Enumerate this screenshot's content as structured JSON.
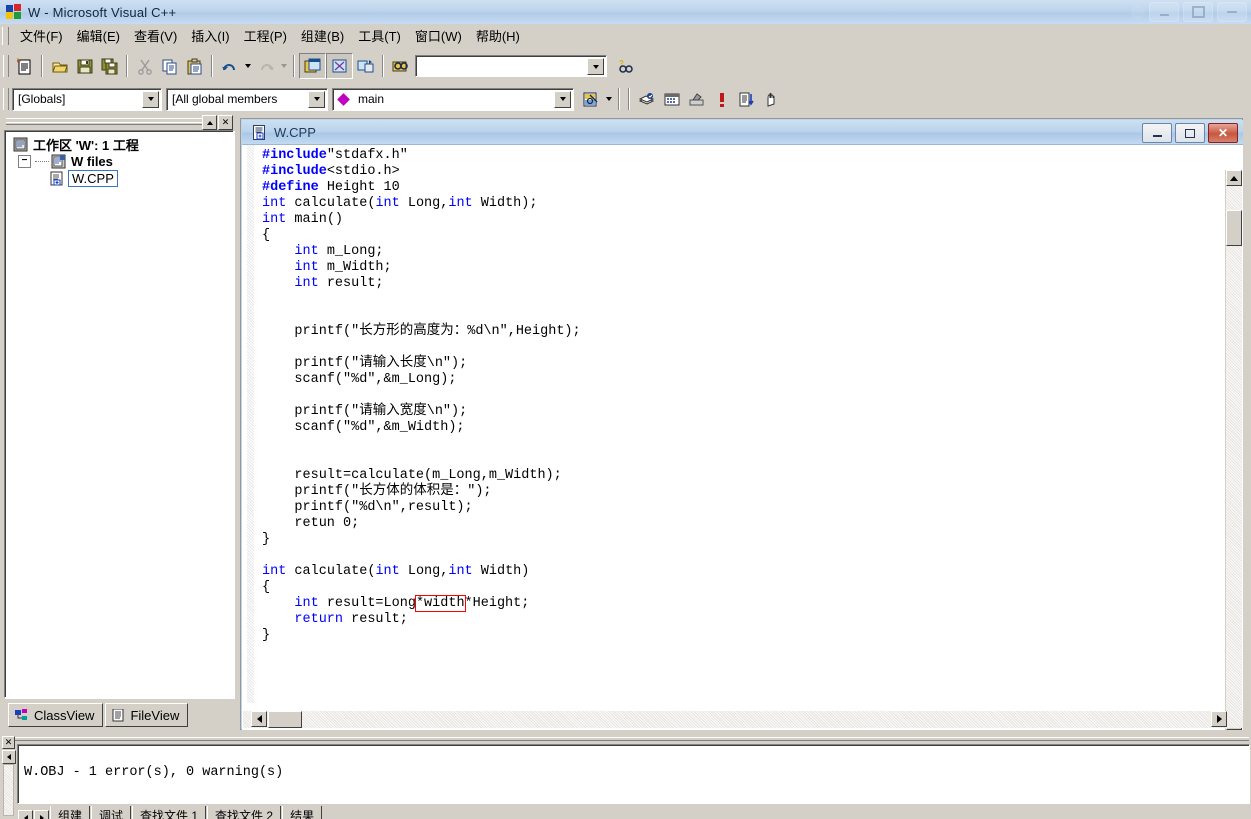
{
  "window": {
    "title": "W - Microsoft Visual C++",
    "icon": "vcpp-logo-icon",
    "buttons": {
      "minimize": "minimize-button",
      "maximize": "maximize-button",
      "close": "close-button"
    }
  },
  "menubar": {
    "items": [
      {
        "label": "文件(F)"
      },
      {
        "label": "编辑(E)"
      },
      {
        "label": "查看(V)"
      },
      {
        "label": "插入(I)"
      },
      {
        "label": "工程(P)"
      },
      {
        "label": "组建(B)"
      },
      {
        "label": "工具(T)"
      },
      {
        "label": "窗口(W)"
      },
      {
        "label": "帮助(H)"
      }
    ]
  },
  "toolbar_standard": {
    "buttons": [
      {
        "name": "new-text-file-icon",
        "tip": "New Text File"
      },
      {
        "name": "open-folder-icon",
        "tip": "Open"
      },
      {
        "name": "save-icon",
        "tip": "Save"
      },
      {
        "name": "save-all-icon",
        "tip": "Save All"
      },
      {
        "name": "cut-scissors-icon",
        "tip": "Cut"
      },
      {
        "name": "copy-icon",
        "tip": "Copy"
      },
      {
        "name": "paste-clipboard-icon",
        "tip": "Paste"
      },
      {
        "name": "undo-icon",
        "tip": "Undo"
      },
      {
        "name": "redo-icon",
        "tip": "Redo"
      },
      {
        "name": "workspace-window-icon",
        "tip": "Workspace"
      },
      {
        "name": "output-window-icon",
        "tip": "Output"
      },
      {
        "name": "window-list-icon",
        "tip": "Windows"
      },
      {
        "name": "find-in-files-icon",
        "tip": "Find in Files"
      },
      {
        "name": "help-find-icon",
        "tip": "Search"
      }
    ],
    "find_combo": {
      "value": "",
      "placeholder": ""
    }
  },
  "toolbar_wizardbar": {
    "scope_combo": {
      "value": "[Globals]"
    },
    "members_combo": {
      "value": "[All global members"
    },
    "function_combo": {
      "value": "main",
      "icon": "member-diamond-icon"
    },
    "buttons": [
      {
        "name": "wizard-action-icon"
      },
      {
        "name": "compile-icon"
      },
      {
        "name": "build-icon"
      },
      {
        "name": "stop-build-icon"
      },
      {
        "name": "execute-program-icon"
      },
      {
        "name": "go-debug-icon"
      },
      {
        "name": "insert-breakpoint-icon"
      }
    ]
  },
  "workspace": {
    "caption_buttons": {
      "roll_up": "roll-up-button",
      "close": "close-button"
    },
    "tree": {
      "root": {
        "label": "工作区 'W': 1 工程",
        "icon": "workspace-icon"
      },
      "project": {
        "label": "W files",
        "icon": "project-folder-icon",
        "expander": "-"
      },
      "file": {
        "label": "W.CPP",
        "icon": "cpp-file-icon",
        "selected": true
      }
    },
    "tabs": [
      {
        "label": "ClassView",
        "icon": "classview-icon",
        "active": false
      },
      {
        "label": "FileView",
        "icon": "fileview-icon",
        "active": true
      }
    ]
  },
  "editor": {
    "title": "W.CPP",
    "title_icon": "source-file-icon",
    "buttons": {
      "minimize": "minimize-button",
      "restore": "restore-button",
      "close": "close-button"
    },
    "code_lines": [
      {
        "segments": [
          {
            "t": "#include",
            "c": "pp"
          },
          {
            "t": "\"stdafx.h\"",
            "c": ""
          }
        ]
      },
      {
        "segments": [
          {
            "t": "#include",
            "c": "pp"
          },
          {
            "t": "<stdio.h>",
            "c": ""
          }
        ]
      },
      {
        "segments": [
          {
            "t": "#define",
            "c": "pp"
          },
          {
            "t": " Height 10",
            "c": ""
          }
        ]
      },
      {
        "segments": [
          {
            "t": "int",
            "c": "kw"
          },
          {
            "t": " calculate(",
            "c": ""
          },
          {
            "t": "int",
            "c": "kw"
          },
          {
            "t": " Long,",
            "c": ""
          },
          {
            "t": "int",
            "c": "kw"
          },
          {
            "t": " Width);",
            "c": ""
          }
        ]
      },
      {
        "segments": [
          {
            "t": "int",
            "c": "kw"
          },
          {
            "t": " main()",
            "c": ""
          }
        ]
      },
      {
        "segments": [
          {
            "t": "{",
            "c": ""
          }
        ]
      },
      {
        "segments": [
          {
            "t": "    ",
            "c": ""
          },
          {
            "t": "int",
            "c": "kw"
          },
          {
            "t": " m_Long;",
            "c": ""
          }
        ]
      },
      {
        "segments": [
          {
            "t": "    ",
            "c": ""
          },
          {
            "t": "int",
            "c": "kw"
          },
          {
            "t": " m_Width;",
            "c": ""
          }
        ]
      },
      {
        "segments": [
          {
            "t": "    ",
            "c": ""
          },
          {
            "t": "int",
            "c": "kw"
          },
          {
            "t": " result;",
            "c": ""
          }
        ]
      },
      {
        "segments": [
          {
            "t": "",
            "c": ""
          }
        ]
      },
      {
        "segments": [
          {
            "t": "",
            "c": ""
          }
        ]
      },
      {
        "segments": [
          {
            "t": "    printf(\"长方形的高度为：%d\\n\",Height);",
            "c": ""
          }
        ]
      },
      {
        "segments": [
          {
            "t": "",
            "c": ""
          }
        ]
      },
      {
        "segments": [
          {
            "t": "    printf(\"请输入长度\\n\");",
            "c": ""
          }
        ]
      },
      {
        "segments": [
          {
            "t": "    scanf(\"%d\",&m_Long);",
            "c": ""
          }
        ]
      },
      {
        "segments": [
          {
            "t": "",
            "c": ""
          }
        ]
      },
      {
        "segments": [
          {
            "t": "    printf(\"请输入宽度\\n\");",
            "c": ""
          }
        ]
      },
      {
        "segments": [
          {
            "t": "    scanf(\"%d\",&m_Width);",
            "c": ""
          }
        ]
      },
      {
        "segments": [
          {
            "t": "",
            "c": ""
          }
        ]
      },
      {
        "segments": [
          {
            "t": "",
            "c": ""
          }
        ]
      },
      {
        "segments": [
          {
            "t": "    result=calculate(m_Long,m_Width);",
            "c": ""
          }
        ]
      },
      {
        "segments": [
          {
            "t": "    printf(\"长方体的体积是：\");",
            "c": ""
          }
        ]
      },
      {
        "segments": [
          {
            "t": "    printf(\"%d\\n\",result);",
            "c": ""
          }
        ]
      },
      {
        "segments": [
          {
            "t": "    retun 0;",
            "c": ""
          }
        ]
      },
      {
        "segments": [
          {
            "t": "}",
            "c": ""
          }
        ]
      },
      {
        "segments": [
          {
            "t": "",
            "c": ""
          }
        ]
      },
      {
        "segments": [
          {
            "t": "int",
            "c": "kw"
          },
          {
            "t": " calculate(",
            "c": ""
          },
          {
            "t": "int",
            "c": "kw"
          },
          {
            "t": " Long,",
            "c": ""
          },
          {
            "t": "int",
            "c": "kw"
          },
          {
            "t": " Width)",
            "c": ""
          }
        ]
      },
      {
        "segments": [
          {
            "t": "{",
            "c": ""
          }
        ]
      },
      {
        "segments": [
          {
            "t": "    ",
            "c": ""
          },
          {
            "t": "int",
            "c": "kw"
          },
          {
            "t": " result=Long",
            "c": ""
          },
          {
            "t": "*width",
            "c": "box"
          },
          {
            "t": "*Height;",
            "c": ""
          }
        ]
      },
      {
        "segments": [
          {
            "t": "    ",
            "c": ""
          },
          {
            "t": "return",
            "c": "kw"
          },
          {
            "t": " result;",
            "c": ""
          }
        ]
      },
      {
        "segments": [
          {
            "t": "}",
            "c": ""
          }
        ]
      }
    ],
    "annotation": {
      "type": "red-rectangle-highlight",
      "text": "*width",
      "color": "#ff0000"
    }
  },
  "output": {
    "close_button": "close-output-button",
    "lines": [
      "W.OBJ - 1 error(s), 0 warning(s)"
    ],
    "tabs": [
      {
        "label": "组建"
      },
      {
        "label": "调试"
      },
      {
        "label": "查找文件 1"
      },
      {
        "label": "查找文件 2"
      },
      {
        "label": "结果"
      }
    ]
  },
  "colors": {
    "keyword_blue": "#0000ff",
    "accent_highlight": "#ff0000",
    "titlebar_blue": "#b9d2ec",
    "chrome_gray": "#d4d0c8",
    "selection_border": "#3a76bd"
  }
}
